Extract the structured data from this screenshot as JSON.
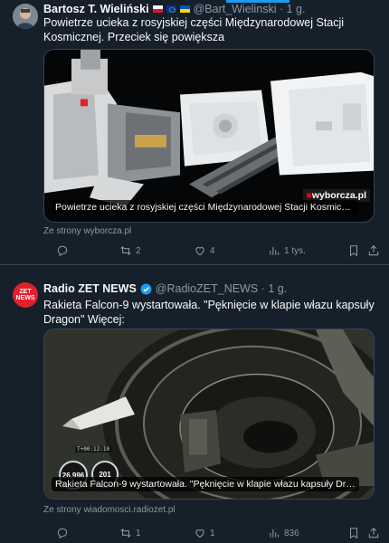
{
  "tweets": [
    {
      "author": "Bartosz T. Wieliński",
      "handle": "@Bart_Wielinski",
      "time": "1 g.",
      "text": "Powietrze ucieka z rosyjskiej części Międzynarodowej Stacji Kosmicznej. Przeciek się powiększa",
      "card_caption": "Powietrze ucieka z rosyjskiej części Międzynarodowej Stacji Kosmicznej. Przeciek się powiększa",
      "card_brand": "wyborcza.pl",
      "source": "Ze strony wyborcza.pl",
      "stats": {
        "replies": "",
        "retweets": "2",
        "likes": "4",
        "views": "1 tys."
      }
    },
    {
      "author": "Radio ZET NEWS",
      "handle": "@RadioZET_NEWS",
      "time": "1 g.",
      "avatar_label": "ZET NEWS",
      "text": "Rakieta Falcon-9 wystartowała. \"Pęknięcie w klapie włazu kapsuły Dragon\" Więcej:",
      "card_caption": "Rakieta Falcon-9 wystartowała. \"Pęknięcie w klapie włazu kapsuły Dragon\"",
      "hud": {
        "timer": "T+00:12:10",
        "gauge1": "26,996",
        "gauge2": "201"
      },
      "source": "Ze strony wiadomosci.radiozet.pl",
      "stats": {
        "replies": "",
        "retweets": "1",
        "likes": "1",
        "views": "836"
      }
    }
  ],
  "colors": {
    "background": "#15202b",
    "text": "#f7f9f9",
    "secondary_text": "#8b98a5",
    "accent": "#1d9bf0",
    "border": "#38444d",
    "radio_zet_red": "#e0202c"
  },
  "icons": [
    "reply-icon",
    "retweet-icon",
    "like-icon",
    "views-icon",
    "bookmark-icon",
    "share-icon",
    "verified-badge-icon"
  ]
}
